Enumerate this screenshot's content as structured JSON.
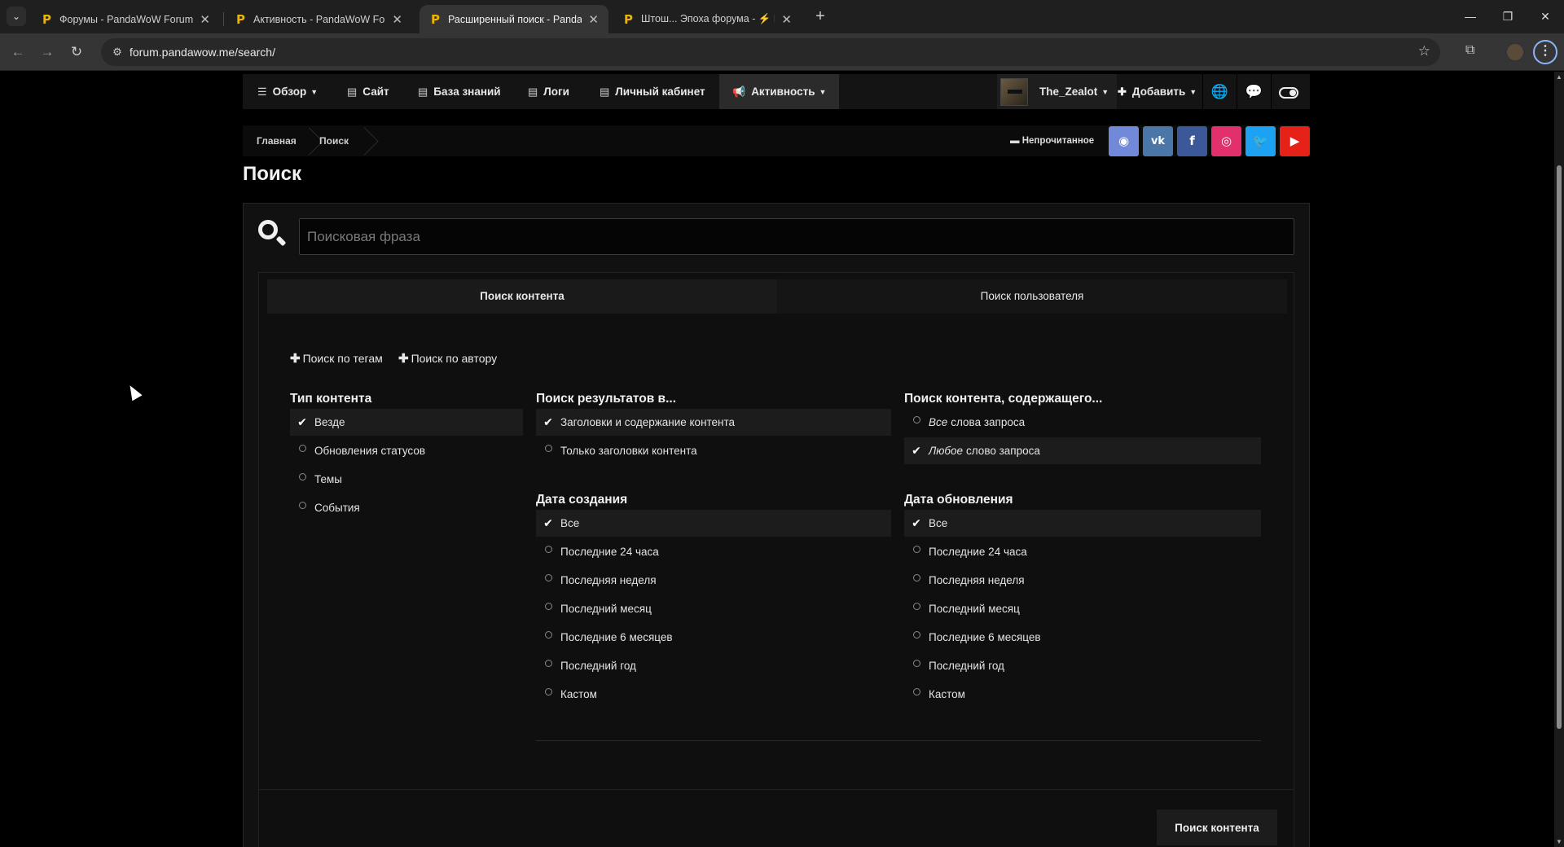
{
  "browser": {
    "tabs": [
      {
        "title": "Форумы - PandaWoW Forum",
        "icon": "P",
        "active": false
      },
      {
        "title": "Активность - PandaWoW Forum",
        "icon": "P",
        "active": false
      },
      {
        "title": "Расширенный поиск - PandaWoW",
        "icon": "P",
        "active": true
      },
      {
        "title": "Штош... Эпоха форума - ⚡ BC",
        "icon": "P",
        "active": false
      }
    ],
    "url": "forum.pandawow.me/search/"
  },
  "nav": {
    "items": [
      {
        "label": "Обзор",
        "icon": "list-icon",
        "caret": true
      },
      {
        "label": "Сайт",
        "icon": "doc-icon"
      },
      {
        "label": "База знаний",
        "icon": "doc-icon"
      },
      {
        "label": "Логи",
        "icon": "doc-icon"
      },
      {
        "label": "Личный кабинет",
        "icon": "doc-icon"
      },
      {
        "label": "Активность",
        "icon": "megaphone-icon",
        "caret": true,
        "active": true
      }
    ],
    "user": "The_Zealot",
    "add_label": "Добавить"
  },
  "breadcrumb": {
    "home": "Главная",
    "current": "Поиск",
    "unread": "Непрочитанное"
  },
  "social": [
    {
      "name": "discord",
      "color": "#7289da"
    },
    {
      "name": "vk",
      "color": "#4a76a8"
    },
    {
      "name": "facebook",
      "color": "#3b5998"
    },
    {
      "name": "instagram",
      "color": "#e1306c"
    },
    {
      "name": "twitter",
      "color": "#1da1f2"
    },
    {
      "name": "youtube",
      "color": "#e62117"
    }
  ],
  "page": {
    "title": "Поиск",
    "search_placeholder": "Поисковая фраза",
    "tabs": {
      "content": "Поиск контента",
      "user": "Поиск пользователя"
    },
    "add_tags": "Поиск по тегам",
    "add_author": "Поиск по автору",
    "content_type": {
      "heading": "Тип контента",
      "options": [
        "Везде",
        "Обновления статусов",
        "Темы",
        "События"
      ],
      "selected": 0
    },
    "search_in": {
      "heading": "Поиск результатов в...",
      "options": [
        "Заголовки и содержание контента",
        "Только заголовки контента"
      ],
      "selected": 0
    },
    "containing": {
      "heading": "Поиск контента, содержащего...",
      "options": [
        {
          "em": "Все",
          "rest": "слова запроса"
        },
        {
          "em": "Любое",
          "rest": "слово запроса"
        }
      ],
      "selected": 1
    },
    "created": {
      "heading": "Дата создания",
      "options": [
        "Все",
        "Последние 24 часа",
        "Последняя неделя",
        "Последний месяц",
        "Последние 6 месяцев",
        "Последний год",
        "Кастом"
      ],
      "selected": 0
    },
    "updated": {
      "heading": "Дата обновления",
      "options": [
        "Все",
        "Последние 24 часа",
        "Последняя неделя",
        "Последний месяц",
        "Последние 6 месяцев",
        "Последний год",
        "Кастом"
      ],
      "selected": 0
    },
    "submit": "Поиск контента"
  }
}
